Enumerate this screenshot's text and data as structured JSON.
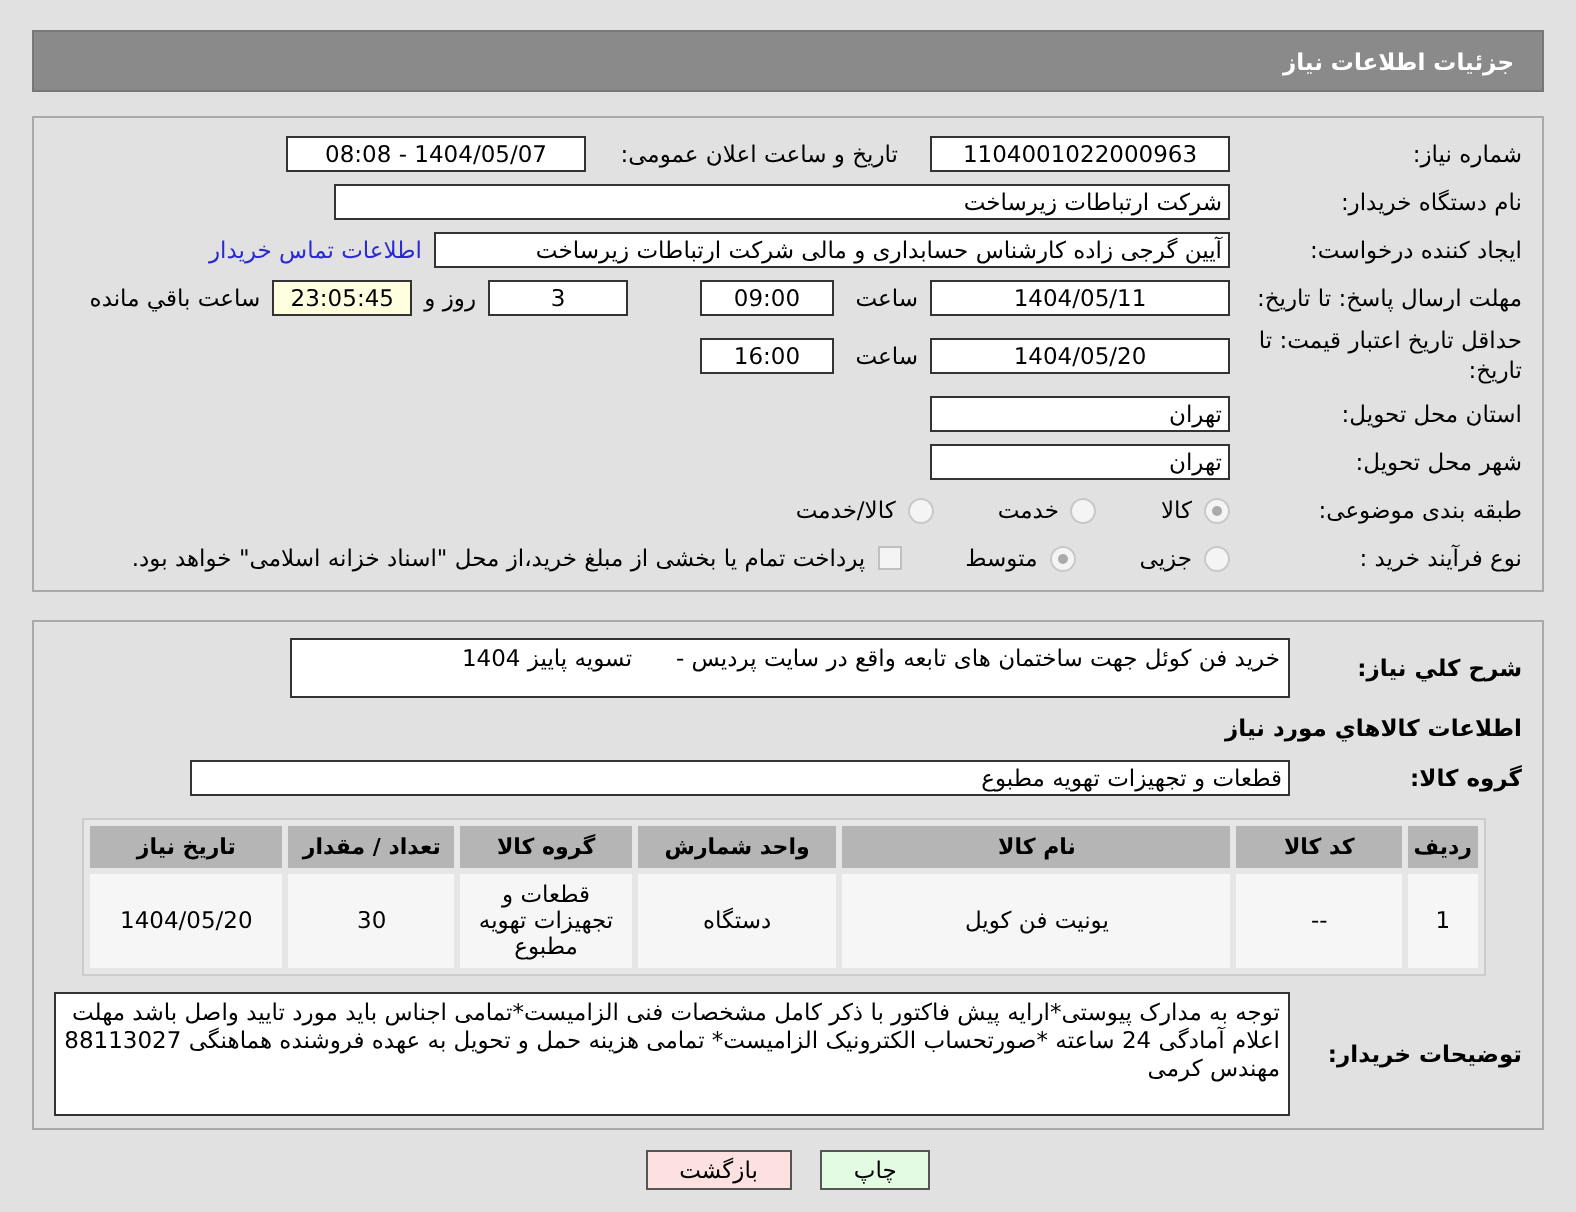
{
  "header": {
    "title": "جزئیات اطلاعات نیاز"
  },
  "fields": {
    "need_number": {
      "label": "شماره نیاز:",
      "value": "1104001022000963"
    },
    "announce": {
      "label": "تاریخ و ساعت اعلان عمومی:",
      "value": "1404/05/07 - 08:08"
    },
    "buyer_org": {
      "label": "نام دستگاه خریدار:",
      "value": "شرکت ارتباطات زیرساخت"
    },
    "creator": {
      "label": "ایجاد کننده درخواست:",
      "value": "آیین گرجی زاده کارشناس حسابداری و مالی شرکت ارتباطات زیرساخت",
      "link": "اطلاعات تماس خریدار"
    },
    "deadline": {
      "label": "مهلت ارسال پاسخ: تا تاریخ:",
      "date": "1404/05/11",
      "time_label": "ساعت",
      "time": "09:00",
      "days": "3",
      "days_label": "روز و",
      "remaining": "23:05:45",
      "remaining_label": "ساعت باقي مانده"
    },
    "validity": {
      "label": "حداقل تاریخ اعتبار قیمت: تا تاریخ:",
      "date": "1404/05/20",
      "time_label": "ساعت",
      "time": "16:00"
    },
    "province": {
      "label": "استان محل تحویل:",
      "value": "تهران"
    },
    "city": {
      "label": "شهر محل تحویل:",
      "value": "تهران"
    },
    "category": {
      "label": "طبقه بندی موضوعی:",
      "options": [
        {
          "label": "کالا",
          "selected": true
        },
        {
          "label": "خدمت",
          "selected": false
        },
        {
          "label": "کالا/خدمت",
          "selected": false
        }
      ]
    },
    "process": {
      "label": "نوع فرآیند خرید :",
      "options": [
        {
          "label": "جزیی",
          "selected": false
        },
        {
          "label": "متوسط",
          "selected": true
        }
      ],
      "payment": {
        "label": "پرداخت تمام یا بخشی از مبلغ خرید،از محل \"اسناد خزانه اسلامی\" خواهد بود.",
        "checked": false
      }
    }
  },
  "description": {
    "label": "شرح کلي نياز:",
    "value": "خرید فن کوئل جهت ساختمان های تابعه واقع در سایت پردیس -      تسویه پاییز 1404"
  },
  "goods_title": "اطلاعات کالاهاي مورد نياز",
  "goods_group": {
    "label": "گروه کالا:",
    "value": "قطعات و تجهیزات تهویه مطبوع"
  },
  "table": {
    "columns": [
      "ردیف",
      "کد کالا",
      "نام کالا",
      "واحد شمارش",
      "گروه کالا",
      "تعداد / مقدار",
      "تاریخ نیاز"
    ],
    "rows": [
      [
        "1",
        "--",
        "یونیت فن کویل",
        "دستگاه",
        "قطعات و تجهیزات تهویه مطبوع",
        "30",
        "1404/05/20"
      ]
    ]
  },
  "buyer_notes": {
    "label": "توضیحات خریدار:",
    "value": "توجه به مدارک پیوستی*ارایه پیش فاکتور با ذکر کامل مشخصات فنی الزامیست*تمامی اجناس باید مورد تایید واصل باشد مهلت اعلام آمادگی 24 ساعته *صورتحساب الکترونیک الزامیست* تمامی هزینه حمل و تحویل به عهده فروشنده هماهنگی 88113027 مهندس کرمی"
  },
  "buttons": [
    {
      "label": "چاپ",
      "kind": "print"
    },
    {
      "label": "بازگشت",
      "kind": "back"
    }
  ]
}
